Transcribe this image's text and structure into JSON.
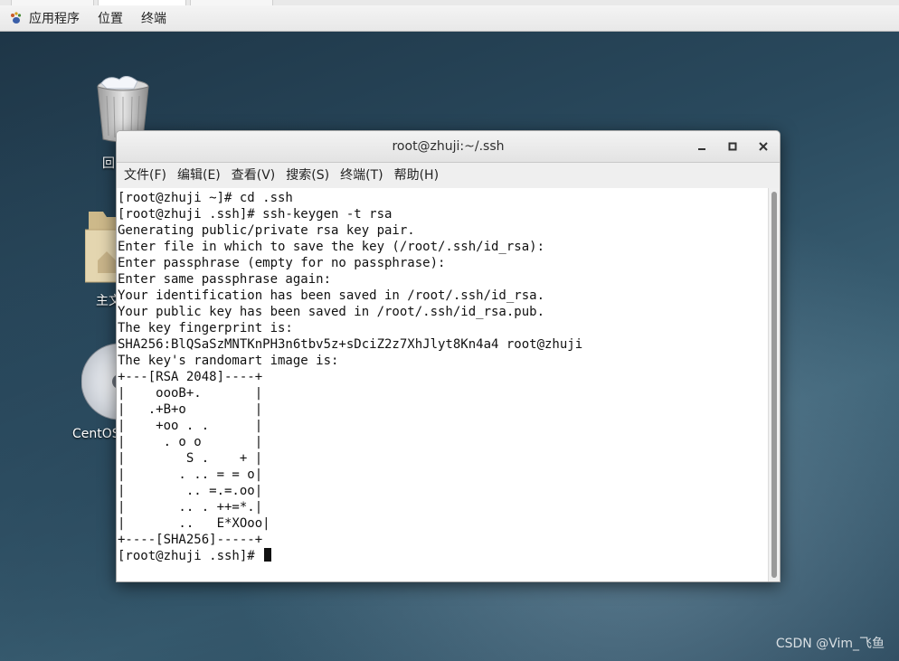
{
  "top_panel": {
    "applications": "应用程序",
    "places": "位置",
    "terminal": "终端"
  },
  "desktop": {
    "icons": [
      {
        "label": "回",
        "icon": "trash-icon"
      },
      {
        "label": "主文",
        "icon": "home-folder-icon"
      },
      {
        "label": "CentOS",
        "icon": "disc-icon"
      }
    ]
  },
  "terminal": {
    "title": "root@zhuji:~/.ssh",
    "menu": [
      "文件(F)",
      "编辑(E)",
      "查看(V)",
      "搜索(S)",
      "终端(T)",
      "帮助(H)"
    ],
    "lines": [
      "[root@zhuji ~]# cd .ssh",
      "[root@zhuji .ssh]# ssh-keygen -t rsa",
      "Generating public/private rsa key pair.",
      "Enter file in which to save the key (/root/.ssh/id_rsa):",
      "Enter passphrase (empty for no passphrase):",
      "Enter same passphrase again:",
      "Your identification has been saved in /root/.ssh/id_rsa.",
      "Your public key has been saved in /root/.ssh/id_rsa.pub.",
      "The key fingerprint is:",
      "SHA256:BlQSaSzMNTKnPH3n6tbv5z+sDciZ2z7XhJlyt8Kn4a4 root@zhuji",
      "The key's randomart image is:",
      "+---[RSA 2048]----+",
      "|    oooB+.       |",
      "|   .+B+o         |",
      "|    +oo . .      |",
      "|     . o o       |",
      "|        S .    + |",
      "|       . .. = = o|",
      "|        .. =.=.oo|",
      "|       .. . ++=*.|",
      "|       ..   E*XOoo|",
      "+----[SHA256]-----+"
    ],
    "prompt": "[root@zhuji .ssh]# "
  },
  "watermark": "CSDN @Vim_飞鱼"
}
